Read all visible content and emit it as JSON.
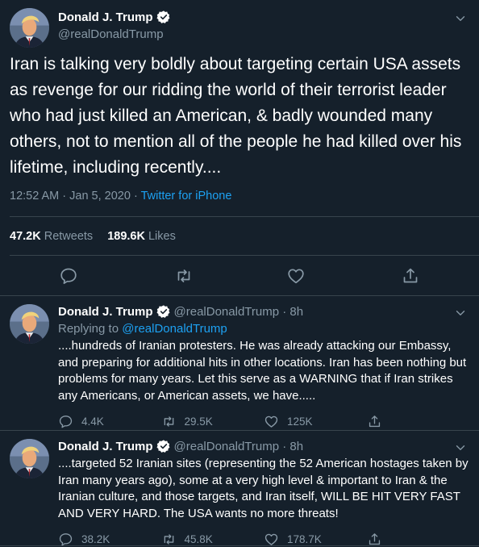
{
  "colors": {
    "background": "#15202b",
    "accent": "#1da1f2",
    "secondary_text": "#8899a6",
    "divider": "#38444d"
  },
  "main_tweet": {
    "author_name": "Donald J. Trump",
    "handle": "@realDonaldTrump",
    "text": "Iran is talking very boldly about targeting certain USA assets as revenge for our ridding the world of their terrorist leader who had just killed an American, & badly wounded many others, not to mention all of the people he had killed over his lifetime, including recently....",
    "timestamp": "12:52 AM · Jan 5, 2020",
    "separator": " · ",
    "source": "Twitter for iPhone",
    "retweets_count": "47.2K",
    "retweets_label": "Retweets",
    "likes_count": "189.6K",
    "likes_label": "Likes"
  },
  "replies": [
    {
      "author_name": "Donald J. Trump",
      "meta": "@realDonaldTrump · 8h",
      "replying_to_label": "Replying to",
      "replying_to_handle": "@realDonaldTrump",
      "text": "....hundreds of Iranian protesters. He was already attacking our Embassy, and preparing for additional hits in other locations. Iran has been nothing but problems for many years. Let this serve as a WARNING that if Iran strikes any Americans, or American assets, we have.....",
      "reply_count": "4.4K",
      "retweet_count": "29.5K",
      "like_count": "125K"
    },
    {
      "author_name": "Donald J. Trump",
      "meta": "@realDonaldTrump · 8h",
      "text": "....targeted 52 Iranian sites (representing the 52 American hostages taken by Iran many years ago), some at a very high level & important to Iran & the Iranian culture, and those targets, and Iran itself, WILL BE HIT VERY FAST AND VERY HARD. The USA wants no more threats!",
      "reply_count": "38.2K",
      "retweet_count": "45.8K",
      "like_count": "178.7K"
    }
  ],
  "icons": [
    "verified-badge-icon",
    "chevron-down-icon",
    "reply-icon",
    "retweet-icon",
    "like-icon",
    "share-icon"
  ]
}
